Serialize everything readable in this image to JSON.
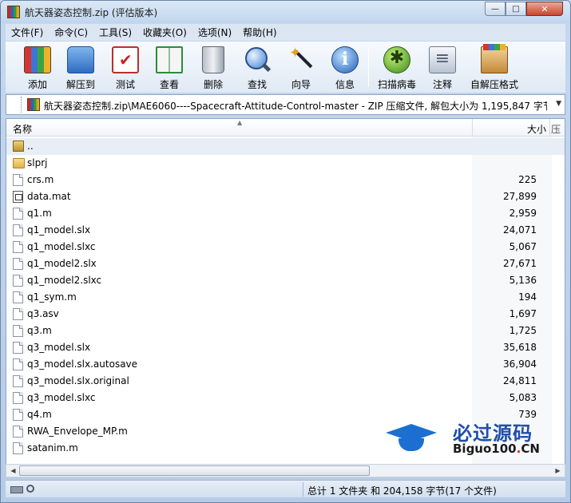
{
  "window": {
    "title": "航天器姿态控制.zip (评估版本)",
    "controls": {
      "minimize": "—",
      "maximize": "□",
      "close": "✕"
    }
  },
  "menu": [
    "文件(F)",
    "命令(C)",
    "工具(S)",
    "收藏夹(O)",
    "选项(N)",
    "帮助(H)"
  ],
  "toolbar": [
    {
      "label": "添加",
      "icon": "add-archive-icon"
    },
    {
      "label": "解压到",
      "icon": "extract-to-icon"
    },
    {
      "label": "测试",
      "icon": "test-icon"
    },
    {
      "label": "查看",
      "icon": "view-book-icon"
    },
    {
      "label": "删除",
      "icon": "trash-icon"
    },
    {
      "label": "查找",
      "icon": "magnifier-icon"
    },
    {
      "label": "向导",
      "icon": "wizard-wand-icon"
    },
    {
      "label": "信息",
      "icon": "info-icon"
    },
    {
      "label": "扫描病毒",
      "icon": "virus-scan-icon"
    },
    {
      "label": "注释",
      "icon": "comment-icon"
    },
    {
      "label": "自解压格式",
      "icon": "sfx-box-icon"
    }
  ],
  "address": {
    "path": "航天器姿态控制.zip\\MAE6060----Spacecraft-Attitude-Control-master - ZIP 压缩文件, 解包大小为 1,195,847 字节"
  },
  "columns": {
    "name": "名称",
    "size": "大小",
    "extra": "压"
  },
  "files": [
    {
      "name": "..",
      "size": "",
      "type": "parent"
    },
    {
      "name": "slprj",
      "size": "",
      "type": "folder"
    },
    {
      "name": "crs.m",
      "size": "225",
      "type": "file"
    },
    {
      "name": "data.mat",
      "size": "27,899",
      "type": "matfile"
    },
    {
      "name": "q1.m",
      "size": "2,959",
      "type": "file"
    },
    {
      "name": "q1_model.slx",
      "size": "24,071",
      "type": "file"
    },
    {
      "name": "q1_model.slxc",
      "size": "5,067",
      "type": "file"
    },
    {
      "name": "q1_model2.slx",
      "size": "27,671",
      "type": "file"
    },
    {
      "name": "q1_model2.slxc",
      "size": "5,136",
      "type": "file"
    },
    {
      "name": "q1_sym.m",
      "size": "194",
      "type": "file"
    },
    {
      "name": "q3.asv",
      "size": "1,697",
      "type": "file"
    },
    {
      "name": "q3.m",
      "size": "1,725",
      "type": "file"
    },
    {
      "name": "q3_model.slx",
      "size": "35,618",
      "type": "file"
    },
    {
      "name": "q3_model.slx.autosave",
      "size": "36,904",
      "type": "file"
    },
    {
      "name": "q3_model.slx.original",
      "size": "24,811",
      "type": "file"
    },
    {
      "name": "q3_model.slxc",
      "size": "5,083",
      "type": "file"
    },
    {
      "name": "q4.m",
      "size": "739",
      "type": "file"
    },
    {
      "name": "RWA_Envelope_MP.m",
      "size": "",
      "type": "file"
    },
    {
      "name": "satanim.m",
      "size": "",
      "type": "file"
    }
  ],
  "status": {
    "text": "总计 1 文件夹 和 204,158 字节(17 个文件)"
  },
  "watermark": {
    "title": "必过源码",
    "domain_main": "Biguo100",
    "domain_dot": ".",
    "domain_tld": "CN"
  }
}
